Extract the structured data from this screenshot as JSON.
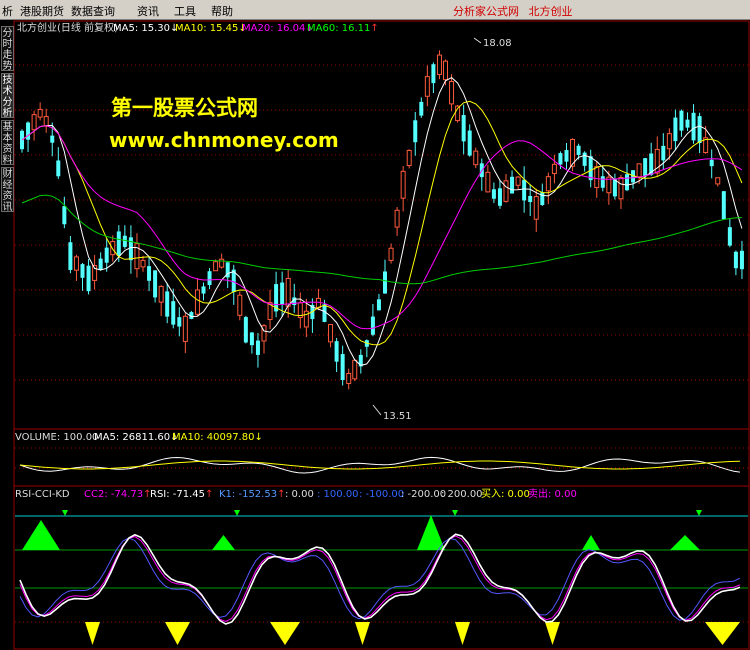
{
  "menu": {
    "items": [
      "析",
      "港股期货",
      "数据查询",
      "资讯",
      "工具",
      "帮助"
    ],
    "brand_site": "分析家公式网",
    "brand_name": "北方创业"
  },
  "side_tabs": [
    "分时走势",
    "技术分析",
    "基本资料",
    "财经资讯"
  ],
  "main_panel": {
    "title": "北方创业(日线 前复权)",
    "ma5": "MA5: 15.30",
    "ma10": "MA10: 15.45",
    "ma20": "MA20: 16.04",
    "ma60": "MA60: 16.11",
    "arrow_up": "↑",
    "arrow_down": "↓",
    "high_label": "18.08",
    "low_label": "13.51"
  },
  "volume_panel": {
    "name": "VOLUME: 100.00",
    "ma5": "MA5: 26811.60",
    "ma10": "MA10: 40097.80"
  },
  "indicator_panel": {
    "name": "RSI-CCI-KD",
    "cc2": "CC2: -74.73",
    "rsi": "RSI: -71.45",
    "k1": "K1: -152.53",
    "v0": ": 0.00",
    "v100": ": 100.00",
    "vm100": ": -100.00",
    "vm200": ": -200.00",
    "v200": ": 200.00",
    "buy": "买入: 0.00",
    "sell": "卖出: 0.00"
  },
  "watermark": {
    "line1": "第一股票公式网",
    "line2": "www.chnmoney.com"
  },
  "colors": {
    "up_candle": "#ff5a3c",
    "down_candle": "#54ffff",
    "ma5": "#ffffff",
    "ma10": "#ffff00",
    "ma20": "#ff00ff",
    "ma60": "#00cc00",
    "grid": "#9a0000",
    "buy_fill": "#00ff00",
    "sell_fill": "#ffff00",
    "line_k": "#ffffff",
    "line_d": "#5555ff",
    "line_j": "#ff00ff"
  }
}
